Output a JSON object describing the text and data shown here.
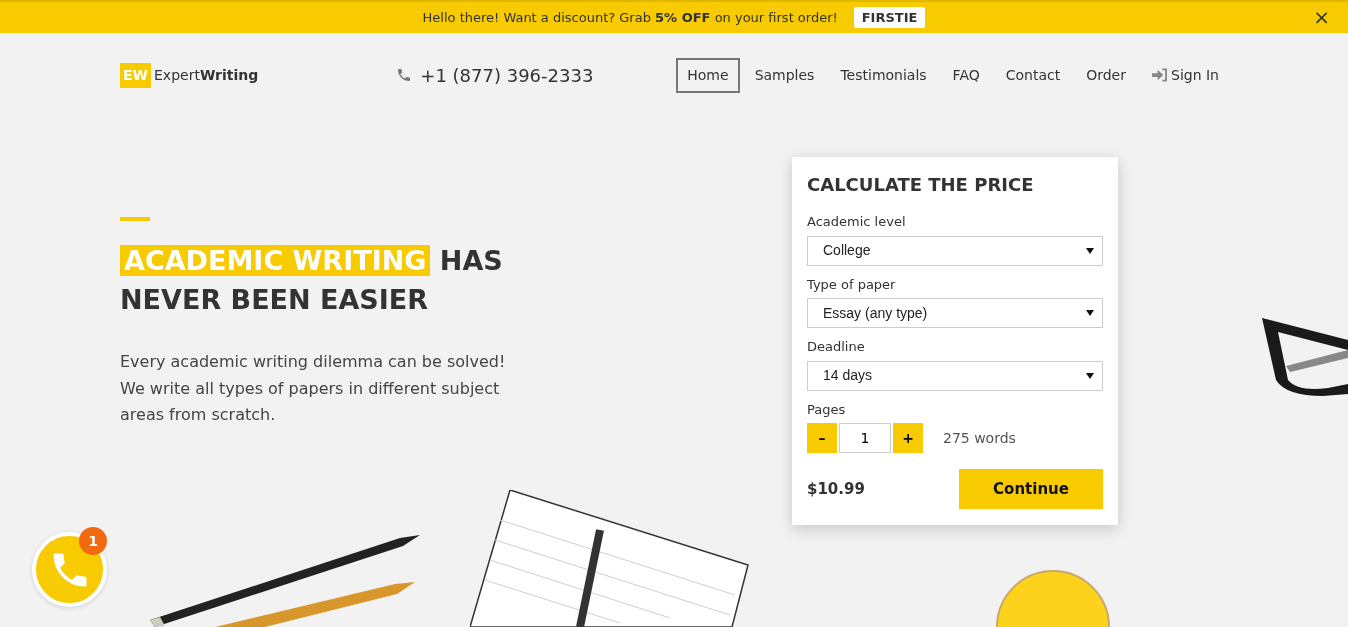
{
  "promo_bar": {
    "message": "Hello there! Want a discount? Grab **5% OFF** on your first order!",
    "code": "FIRSTIE",
    "close": "×"
  },
  "header": {
    "logo_mark": "EW",
    "logo_text_light": "Expert",
    "logo_text_bold": "Writing",
    "phone": "+1 (877) 396-2333",
    "nav": [
      {
        "label": "Home",
        "selected": true,
        "kind": "link"
      },
      {
        "label": "Samples",
        "selected": false,
        "kind": "link"
      },
      {
        "label": "Testimonials",
        "selected": false,
        "kind": "link"
      },
      {
        "label": "FAQ",
        "selected": false,
        "kind": "link"
      },
      {
        "label": "Contact",
        "selected": false,
        "kind": "link"
      },
      {
        "label": "Order",
        "selected": false,
        "kind": "link"
      },
      {
        "label": "Sign In",
        "selected": false,
        "kind": "signin"
      }
    ]
  },
  "hero": {
    "heading_highlight": "ACADEMIC WRITING",
    "heading_rest": "HAS NEVER BEEN EASIER",
    "text": "Every academic writing dilemma can be solved! We write all types of papers in different subject areas from scratch."
  },
  "calculator": {
    "title": "CALCULATE THE PRICE",
    "fields": [
      {
        "label": "Academic level",
        "value": "College"
      },
      {
        "label": "Type of paper",
        "value": "Essay (any type)"
      },
      {
        "label": "Deadline",
        "value": "14 days"
      }
    ],
    "pages": {
      "label": "Pages",
      "minus": "–",
      "value": "1",
      "plus": "+",
      "words": "275 words"
    },
    "price": "$10.99",
    "button": "Continue"
  },
  "call_widget": {
    "badge": "1"
  }
}
